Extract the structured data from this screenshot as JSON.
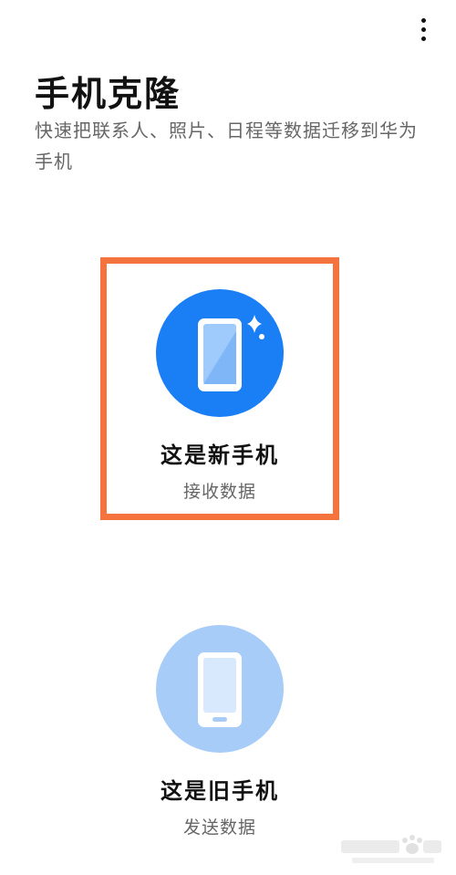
{
  "header": {
    "title": "手机克隆",
    "subtitle": "快速把联系人、照片、日程等数据迁移到华为手机",
    "more_icon": "more-vertical-icon"
  },
  "options": [
    {
      "title": "这是新手机",
      "subtitle": "接收数据",
      "icon": "new-phone-icon",
      "color": "#1a7ff5",
      "highlighted": true,
      "highlight_color": "#f4733f"
    },
    {
      "title": "这是旧手机",
      "subtitle": "发送数据",
      "icon": "old-phone-icon",
      "color": "#a8ccf8",
      "highlighted": false
    }
  ],
  "watermark": {
    "icon": "baidu-jingyan-watermark-icon"
  }
}
